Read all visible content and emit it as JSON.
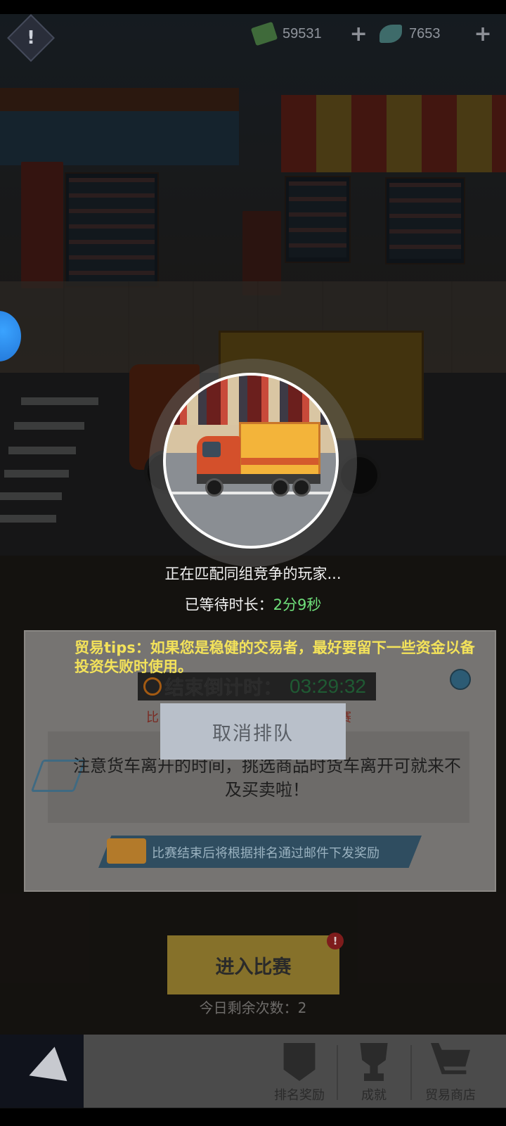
{
  "topbar": {
    "alert_label": "!",
    "cash_value": "59531",
    "cash_plus": "+",
    "gem_value": "7653",
    "gem_plus": "+"
  },
  "matching": {
    "status_text": "正在匹配同组竞争的玩家...",
    "wait_label": "已等待时长：",
    "wait_value": "2分9秒",
    "cancel_label": "取消排队"
  },
  "tips": {
    "text": "贸易tips：如果您是稳健的交易者，最好要留下一些资金以备投资失败时使用。"
  },
  "panel": {
    "countdown_label": "结束倒计时：",
    "countdown_value": "03:29:32",
    "red_fragment_left": "比",
    "red_fragment_right": "赛",
    "notice_text": "注意货车离开的时间，挑选商品时货车离开可就来不及买卖啦！",
    "reward_text": "比赛结束后将根据排名通过邮件下发奖励"
  },
  "enter": {
    "label": "进入比赛",
    "badge": "!",
    "remaining_text": "今日剩余次数：2"
  },
  "bottom_nav": {
    "items": [
      {
        "label": "排名奖励",
        "icon": "rank-reward-icon"
      },
      {
        "label": "成就",
        "icon": "trophy-icon"
      },
      {
        "label": "贸易商店",
        "icon": "shopping-cart-icon"
      }
    ]
  },
  "colors": {
    "wait_value": "#6fe07b",
    "tips": "#f3e25a",
    "cancel_button": "#b9c0ca",
    "enter_button": "#86712a"
  }
}
